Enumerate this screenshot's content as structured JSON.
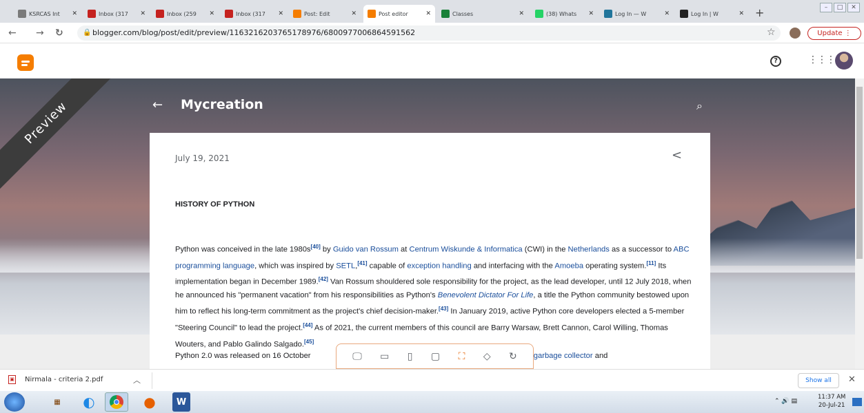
{
  "browser": {
    "tabs": [
      {
        "label": "KSRCAS Int",
        "icon": "ksrcas-favicon-icon",
        "color": "#7a7a7a"
      },
      {
        "label": "Inbox (317",
        "icon": "gmail-icon",
        "color": "#c5221f"
      },
      {
        "label": "Inbox (259",
        "icon": "gmail-icon",
        "color": "#c5221f"
      },
      {
        "label": "Inbox (317",
        "icon": "gmail-icon",
        "color": "#c5221f"
      },
      {
        "label": "Post: Edit",
        "icon": "blogger-icon",
        "color": "#f57d00"
      },
      {
        "label": "Post editor",
        "icon": "blogger-icon",
        "color": "#f57d00"
      },
      {
        "label": "Classes",
        "icon": "classroom-icon",
        "color": "#188038"
      },
      {
        "label": "(38) Whats",
        "icon": "whatsapp-icon",
        "color": "#25d366"
      },
      {
        "label": "Log In — W",
        "icon": "wordpress-icon",
        "color": "#21759b"
      },
      {
        "label": "Log In | W",
        "icon": "wix-icon",
        "color": "#222222"
      }
    ],
    "active_tab": 5,
    "new_tab": "+",
    "url": "blogger.com/blog/post/edit/preview/1163216203765178976/6800977006864591562",
    "update_label": "Update"
  },
  "blogger": {
    "help_icon": "?",
    "apps_icon": "⋮⋮⋮"
  },
  "preview": {
    "ribbon_label": "Preview",
    "blog_title": "Mycreation",
    "post_date": "July 19, 2021",
    "heading": "HISTORY OF PYTHON",
    "paragraph1": {
      "t1": "Python was conceived in the late 1980s",
      "s1": "[40]",
      "t2": " by ",
      "l1": "Guido van Rossum",
      "t3": " at ",
      "l2": "Centrum Wiskunde & Informatica",
      "t4": " (CWI) in the ",
      "l3": "Netherlands",
      "t5": " as a successor to ",
      "l4": "ABC programming language",
      "t6": ", which was inspired by ",
      "l5": "SETL",
      "t7": ",",
      "s2": "[41]",
      "t8": " capable of ",
      "l6": "exception handling",
      "t9": " and interfacing with the ",
      "l7": "Amoeba",
      "t10": " operating system.",
      "s3": "[11]",
      "t11": " Its implementation began in December 1989.",
      "s4": "[42]",
      "t12": " Van Rossum shouldered sole responsibility for the project, as the lead developer, until 12 July 2018, when he announced his \"permanent vacation\" from his responsibilities as Python's ",
      "l8": "Benevolent Dictator For Life",
      "t13": ", a title the Python community bestowed upon him to reflect his long-term commitment as the project's chief decision-maker.",
      "s5": "[43]",
      "t14": " In January 2019, active Python core developers elected a 5-member \"Steering Council\" to lead the project.",
      "s6": "[44]",
      "t15": " As of 2021, the current members of this council are Barry Warsaw, Brett Cannon, Carol Willing, Thomas Wouters, and Pablo Galindo Salgado.",
      "s7": "[45]"
    },
    "paragraph2": {
      "t1": "Python 2.0 was released on 16 October ",
      "l1": "ycle-detecting garbage collector",
      "t2": " and"
    }
  },
  "download_bar": {
    "file_name": "Nirmala - criteria 2.pdf",
    "show_all": "Show all"
  },
  "taskbar": {
    "time": "11:37 AM",
    "date": "20-Jul-21"
  }
}
